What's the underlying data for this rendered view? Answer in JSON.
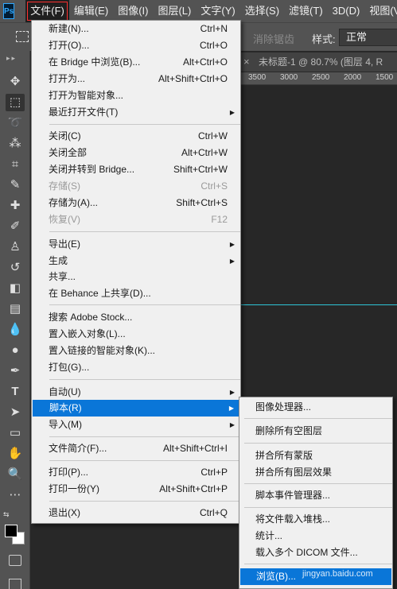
{
  "app_logo": "Ps",
  "menubar": {
    "items": [
      "文件(F)",
      "编辑(E)",
      "图像(I)",
      "图层(L)",
      "文字(Y)",
      "选择(S)",
      "滤镜(T)",
      "3D(D)",
      "视图(V)"
    ]
  },
  "options": {
    "antialias_label": "消除锯齿",
    "style_label": "样式:",
    "style_value": "正常"
  },
  "document": {
    "tab_title": "未标题-1 @ 80.7% (图层 4, R",
    "close_glyph": "×",
    "ruler_labels": [
      "3500",
      "3000",
      "2500",
      "2000",
      "1500"
    ]
  },
  "file_menu": {
    "items": [
      {
        "label": "新建(N)...",
        "shortcut": "Ctrl+N"
      },
      {
        "label": "打开(O)...",
        "shortcut": "Ctrl+O"
      },
      {
        "label": "在 Bridge 中浏览(B)...",
        "shortcut": "Alt+Ctrl+O"
      },
      {
        "label": "打开为...",
        "shortcut": "Alt+Shift+Ctrl+O"
      },
      {
        "label": "打开为智能对象...",
        "shortcut": ""
      },
      {
        "label": "最近打开文件(T)",
        "shortcut": "",
        "submenu": true
      },
      {
        "label": "关闭(C)",
        "shortcut": "Ctrl+W"
      },
      {
        "label": "关闭全部",
        "shortcut": "Alt+Ctrl+W"
      },
      {
        "label": "关闭并转到 Bridge...",
        "shortcut": "Shift+Ctrl+W"
      },
      {
        "label": "存储(S)",
        "shortcut": "Ctrl+S",
        "disabled": true
      },
      {
        "label": "存储为(A)...",
        "shortcut": "Shift+Ctrl+S"
      },
      {
        "label": "恢复(V)",
        "shortcut": "F12",
        "disabled": true
      },
      {
        "label": "导出(E)",
        "shortcut": "",
        "submenu": true
      },
      {
        "label": "生成",
        "shortcut": "",
        "submenu": true
      },
      {
        "label": "共享...",
        "shortcut": ""
      },
      {
        "label": "在 Behance 上共享(D)...",
        "shortcut": ""
      },
      {
        "label": "搜索 Adobe Stock...",
        "shortcut": ""
      },
      {
        "label": "置入嵌入对象(L)...",
        "shortcut": ""
      },
      {
        "label": "置入链接的智能对象(K)...",
        "shortcut": ""
      },
      {
        "label": "打包(G)...",
        "shortcut": ""
      },
      {
        "label": "自动(U)",
        "shortcut": "",
        "submenu": true
      },
      {
        "label": "脚本(R)",
        "shortcut": "",
        "submenu": true,
        "highlighted": true
      },
      {
        "label": "导入(M)",
        "shortcut": "",
        "submenu": true
      },
      {
        "label": "文件简介(F)...",
        "shortcut": "Alt+Shift+Ctrl+I"
      },
      {
        "label": "打印(P)...",
        "shortcut": "Ctrl+P"
      },
      {
        "label": "打印一份(Y)",
        "shortcut": "Alt+Shift+Ctrl+P"
      },
      {
        "label": "退出(X)",
        "shortcut": "Ctrl+Q"
      }
    ]
  },
  "scripts_submenu": {
    "items": [
      {
        "label": "图像处理器..."
      },
      {
        "label": "删除所有空图层"
      },
      {
        "label": "拼合所有蒙版"
      },
      {
        "label": "拼合所有图层效果"
      },
      {
        "label": "脚本事件管理器..."
      },
      {
        "label": "将文件载入堆栈..."
      },
      {
        "label": "统计..."
      },
      {
        "label": "载入多个 DICOM 文件..."
      },
      {
        "label": "浏览(B)...",
        "highlighted": true
      }
    ]
  },
  "watermark": "jingyan.baidu.com",
  "tools": [
    "move-icon",
    "rect-marquee-icon",
    "lasso-icon",
    "magic-wand-icon",
    "crop-icon",
    "eyedropper-icon",
    "healing-brush-icon",
    "brush-icon",
    "clone-stamp-icon",
    "history-brush-icon",
    "eraser-icon",
    "gradient-icon",
    "blur-icon",
    "dodge-icon",
    "pen-icon",
    "type-icon",
    "path-select-icon",
    "rectangle-icon",
    "hand-icon",
    "zoom-icon",
    "more-tools-icon"
  ],
  "colors": {
    "accent": "#0a76d8",
    "panel": "#535353",
    "canvas": "#282828",
    "menu_bg": "#f0f0f0"
  }
}
